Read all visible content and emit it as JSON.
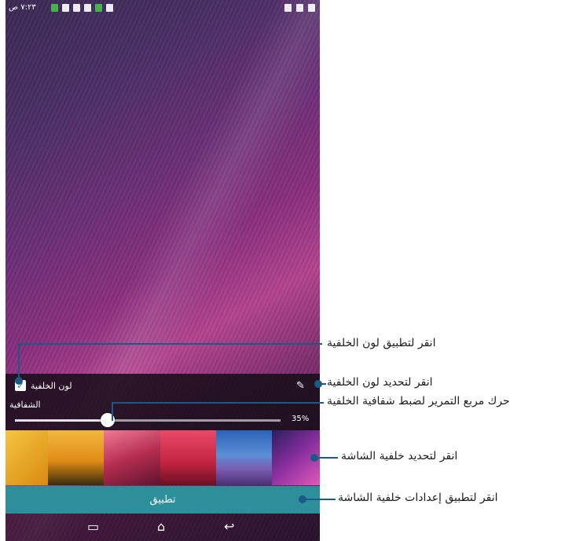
{
  "status_bar": {
    "time": "٧:٢٣ ص"
  },
  "panel": {
    "background_color_label": "لون الخلفية",
    "background_color_checked": true,
    "transparency_label": "الشفافية",
    "transparency_value_text": "35%",
    "transparency_percent": 35
  },
  "thumbnails": [
    {
      "name": "yellow-petals",
      "color": "#e0a51a"
    },
    {
      "name": "sunset-sea",
      "color": "#c78a1c"
    },
    {
      "name": "pink-fabric",
      "color": "#c23a55"
    },
    {
      "name": "red-horizon",
      "color": "#cc2b44"
    },
    {
      "name": "lavender-field",
      "color": "#3a75c4"
    },
    {
      "name": "purple-waves",
      "color": "#7a2f8f"
    }
  ],
  "apply_button": {
    "label": "تطبيق"
  },
  "callouts": [
    "انقر لتطبيق لون الخلفية",
    "انقر لتحديد لون الخلفية",
    "حرك مربع التمرير لضبط شفافية الخلفية",
    "انقر لتحديد خلفية الشاشة",
    "انقر لتطبيق إعدادات خلفية الشاشة"
  ],
  "colors": {
    "accent": "#2c8f9a",
    "callout_line": "#1a5b86"
  }
}
